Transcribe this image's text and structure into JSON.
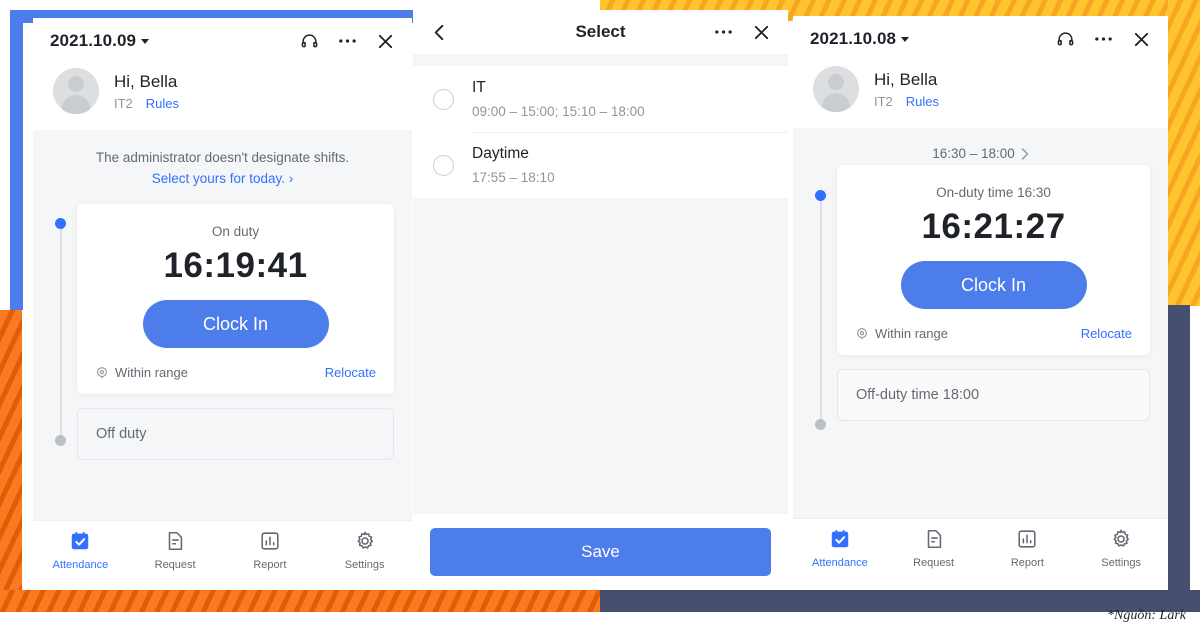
{
  "decor": {
    "blue": "#4c7dea",
    "yellow": "#ffc42e",
    "orange": "#fb7a1e",
    "navy": "#464f6e"
  },
  "footer": {
    "credit": "*Nguồn: Lark"
  },
  "panel1": {
    "topbar": {
      "date": "2021.10.09",
      "icons": [
        "headset-icon",
        "more-icon",
        "close-icon"
      ]
    },
    "profile": {
      "greeting": "Hi, Bella",
      "department": "IT2",
      "rules_link": "Rules",
      "avatar": "avatar"
    },
    "notice": {
      "line1": "The administrator doesn't designate shifts.",
      "line2": "Select yours for today. ›"
    },
    "clock_card": {
      "label": "On duty",
      "time": "16:19:41",
      "button": "Clock In",
      "location_status": "Within range",
      "relocate": "Relocate"
    },
    "offduty": {
      "label": "Off duty"
    },
    "tabs": [
      {
        "label": "Attendance",
        "icon": "calendar-check-icon",
        "active": true
      },
      {
        "label": "Request",
        "icon": "document-icon",
        "active": false
      },
      {
        "label": "Report",
        "icon": "bar-chart-icon",
        "active": false
      },
      {
        "label": "Settings",
        "icon": "gear-icon",
        "active": false
      }
    ]
  },
  "panel2": {
    "topbar": {
      "back": "back-icon",
      "title": "Select",
      "icons": [
        "more-icon",
        "close-icon"
      ]
    },
    "options": [
      {
        "name": "IT",
        "hours": "09:00 – 15:00; 15:10 – 18:00",
        "selected": false
      },
      {
        "name": "Daytime",
        "hours": "17:55 – 18:10",
        "selected": false
      }
    ],
    "save_button": "Save"
  },
  "panel3": {
    "topbar": {
      "date": "2021.10.08",
      "icons": [
        "headset-icon",
        "more-icon",
        "close-icon"
      ]
    },
    "profile": {
      "greeting": "Hi, Bella",
      "department": "IT2",
      "rules_link": "Rules",
      "avatar": "avatar"
    },
    "shift_range": "16:30 – 18:00",
    "clock_card": {
      "label": "On-duty time 16:30",
      "time": "16:21:27",
      "button": "Clock In",
      "location_status": "Within range",
      "relocate": "Relocate"
    },
    "offduty": {
      "label": "Off-duty time 18:00"
    },
    "tabs": [
      {
        "label": "Attendance",
        "icon": "calendar-check-icon",
        "active": true
      },
      {
        "label": "Request",
        "icon": "document-icon",
        "active": false
      },
      {
        "label": "Report",
        "icon": "bar-chart-icon",
        "active": false
      },
      {
        "label": "Settings",
        "icon": "gear-icon",
        "active": false
      }
    ]
  }
}
